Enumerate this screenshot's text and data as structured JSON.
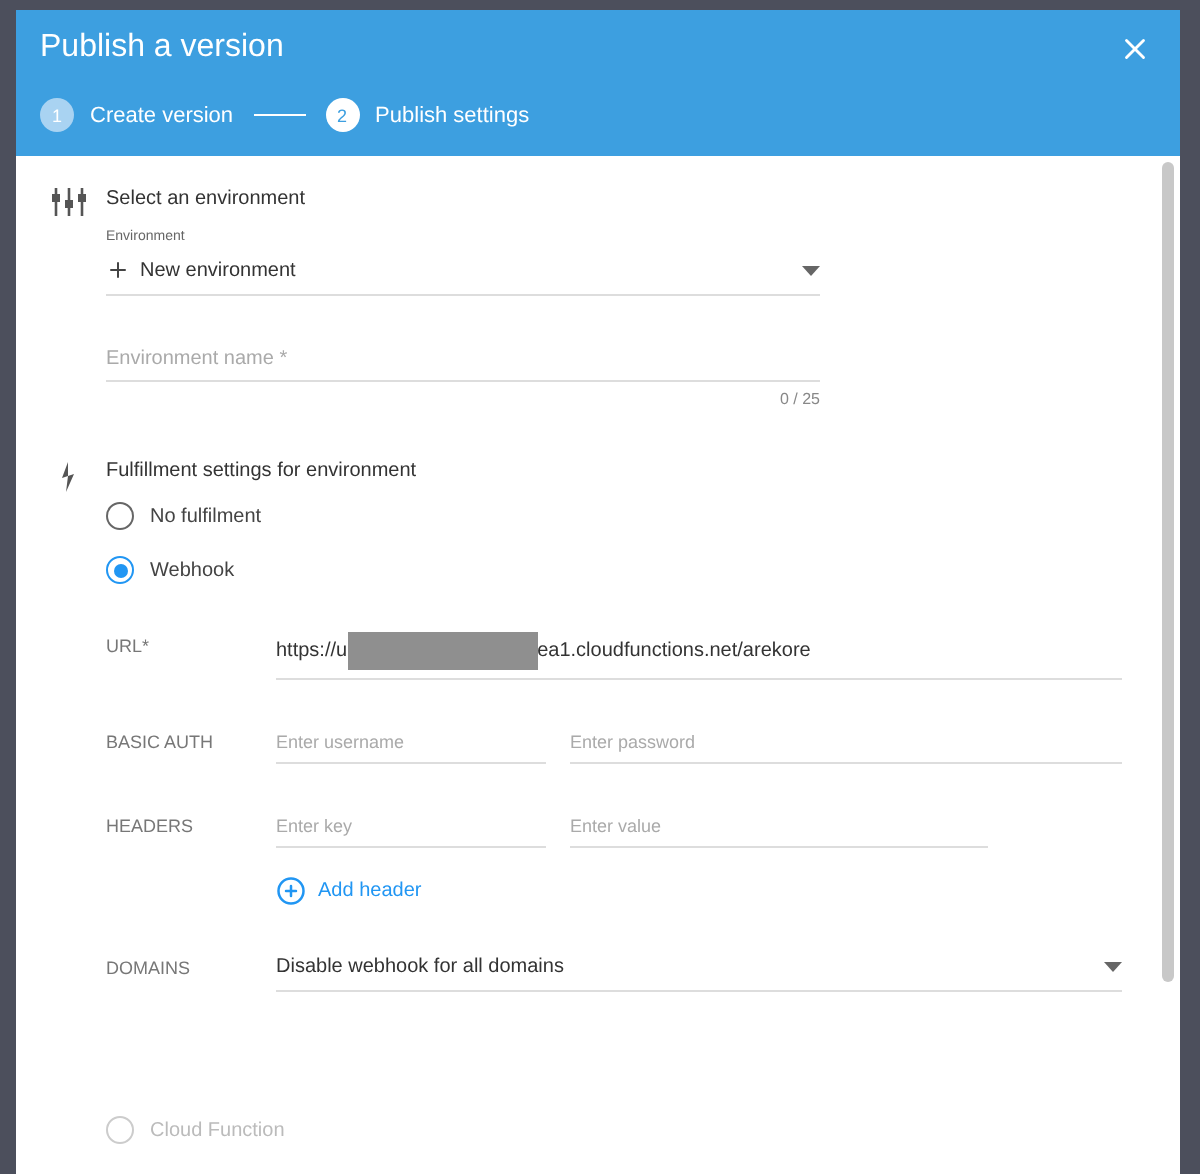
{
  "dialog": {
    "title": "Publish a version"
  },
  "steps": [
    {
      "number": "1",
      "label": "Create version",
      "selected": false
    },
    {
      "number": "2",
      "label": "Publish settings",
      "selected": true
    }
  ],
  "environment_section": {
    "heading": "Select an environment",
    "environment_select": {
      "label": "Environment",
      "value": "New environment"
    },
    "name_field": {
      "placeholder": "Environment name *",
      "counter": "0 / 25"
    }
  },
  "fulfillment_section": {
    "heading": "Fulfillment settings for environment",
    "options": [
      {
        "label": "No fulfilment",
        "selected": false,
        "disabled": false
      },
      {
        "label": "Webhook",
        "selected": true,
        "disabled": false
      },
      {
        "label": "Cloud Function",
        "selected": false,
        "disabled": true
      }
    ],
    "webhook": {
      "url": {
        "label": "URL*",
        "value_start": "https://u",
        "value_end": "ea1.cloudfunctions.net/arekore"
      },
      "basic_auth": {
        "label": "BASIC AUTH",
        "username_placeholder": "Enter username",
        "password_placeholder": "Enter password"
      },
      "headers": {
        "label": "HEADERS",
        "key_placeholder": "Enter key",
        "value_placeholder": "Enter value",
        "add_label": "Add header"
      },
      "domains": {
        "label": "DOMAINS",
        "value": "Disable webhook for all domains"
      }
    }
  }
}
